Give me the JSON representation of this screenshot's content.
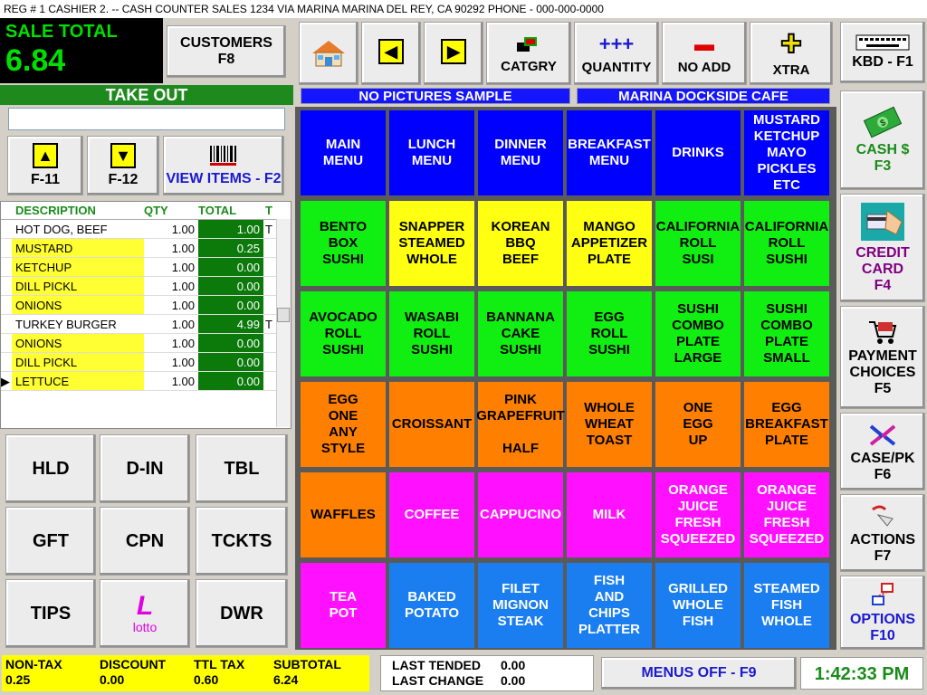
{
  "title": "REG # 1 CASHIER 2. -- CASH COUNTER SALES 1234 VIA MARINA MARINA DEL REY, CA 90292 PHONE - 000-000-0000",
  "sale": {
    "label": "SALE TOTAL",
    "value": "6.84"
  },
  "customers": {
    "line1": "CUSTOMERS",
    "line2": "F8"
  },
  "order_type": "TAKE OUT",
  "nav": {
    "up_label": "F-11",
    "down_label": "F-12",
    "view_items": "VIEW ITEMS - F2"
  },
  "grid": {
    "headers": [
      "DESCRIPTION",
      "QTY",
      "TOTAL",
      "T"
    ],
    "rows": [
      {
        "desc": "HOT DOG, BEEF",
        "qty": "1.00",
        "total": "1.00",
        "t": "T",
        "mod": false
      },
      {
        "desc": "MUSTARD",
        "qty": "1.00",
        "total": "0.25",
        "t": "",
        "mod": true
      },
      {
        "desc": "KETCHUP",
        "qty": "1.00",
        "total": "0.00",
        "t": "",
        "mod": true
      },
      {
        "desc": "DILL PICKL",
        "qty": "1.00",
        "total": "0.00",
        "t": "",
        "mod": true
      },
      {
        "desc": "ONIONS",
        "qty": "1.00",
        "total": "0.00",
        "t": "",
        "mod": true
      },
      {
        "desc": "TURKEY BURGER",
        "qty": "1.00",
        "total": "4.99",
        "t": "T",
        "mod": false
      },
      {
        "desc": "ONIONS",
        "qty": "1.00",
        "total": "0.00",
        "t": "",
        "mod": true
      },
      {
        "desc": "DILL PICKL",
        "qty": "1.00",
        "total": "0.00",
        "t": "",
        "mod": true
      },
      {
        "desc": "LETTUCE",
        "qty": "1.00",
        "total": "0.00",
        "t": "",
        "mod": true
      }
    ]
  },
  "func": {
    "hld": "HLD",
    "din": "D-IN",
    "tbl": "TBL",
    "gft": "GFT",
    "cpn": "CPN",
    "tckts": "TCKTS",
    "tips": "TIPS",
    "lotto_l": "L",
    "lotto": "lotto",
    "dwr": "DWR"
  },
  "toolbar": {
    "catgry": "CATGRY",
    "quantity": "QUANTITY",
    "noadd": "NO ADD",
    "xtra": "XTRA",
    "qty_icon": "+++",
    "noadd_icon": "▬",
    "xtra_icon": "✚"
  },
  "banners": {
    "left": "NO PICTURES SAMPLE",
    "right": "MARINA DOCKSIDE CAFE"
  },
  "menu": [
    [
      {
        "t": "MAIN\nMENU",
        "c": "blue"
      },
      {
        "t": "LUNCH\nMENU",
        "c": "blue"
      },
      {
        "t": "DINNER\nMENU",
        "c": "blue"
      },
      {
        "t": "BREAKFAST\nMENU",
        "c": "blue"
      },
      {
        "t": "DRINKS",
        "c": "blue"
      },
      {
        "t": "MUSTARD\nKETCHUP\nMAYO\nPICKLES\nETC",
        "c": "blue"
      }
    ],
    [
      {
        "t": "BENTO\nBOX\nSUSHI",
        "c": "green"
      },
      {
        "t": "SNAPPER\nSTEAMED\nWHOLE",
        "c": "yellow"
      },
      {
        "t": "KOREAN\nBBQ\nBEEF",
        "c": "yellow"
      },
      {
        "t": "MANGO\nAPPETIZER\nPLATE",
        "c": "yellow"
      },
      {
        "t": "CALIFORNIA\nROLL\nSUSI",
        "c": "green"
      },
      {
        "t": "CALIFORNIA\nROLL\nSUSHI",
        "c": "green"
      }
    ],
    [
      {
        "t": "AVOCADO\nROLL\nSUSHI",
        "c": "green"
      },
      {
        "t": "WASABI\nROLL\nSUSHI",
        "c": "green"
      },
      {
        "t": "BANNANA\nCAKE\nSUSHI",
        "c": "green"
      },
      {
        "t": "EGG\nROLL\nSUSHI",
        "c": "green"
      },
      {
        "t": "SUSHI\nCOMBO\nPLATE\nLARGE",
        "c": "green"
      },
      {
        "t": "SUSHI\nCOMBO\nPLATE\nSMALL",
        "c": "green"
      }
    ],
    [
      {
        "t": "EGG\nONE\nANY\nSTYLE",
        "c": "orange"
      },
      {
        "t": "CROISSANT",
        "c": "orange"
      },
      {
        "t": "PINK\nGRAPEFRUIT\n\nHALF",
        "c": "orange"
      },
      {
        "t": "WHOLE\nWHEAT\nTOAST",
        "c": "orange"
      },
      {
        "t": "ONE\nEGG\nUP",
        "c": "orange"
      },
      {
        "t": "EGG\nBREAKFAST\nPLATE",
        "c": "orange"
      }
    ],
    [
      {
        "t": "WAFFLES",
        "c": "orange"
      },
      {
        "t": "COFFEE",
        "c": "magenta"
      },
      {
        "t": "CAPPUCINO",
        "c": "magenta"
      },
      {
        "t": "MILK",
        "c": "magenta"
      },
      {
        "t": "ORANGE\nJUICE\nFRESH\nSQUEEZED",
        "c": "magenta"
      },
      {
        "t": "ORANGE\nJUICE\nFRESH\nSQUEEZED",
        "c": "magenta"
      }
    ],
    [
      {
        "t": "TEA\nPOT",
        "c": "magenta"
      },
      {
        "t": "BAKED\nPOTATO",
        "c": "sky"
      },
      {
        "t": "FILET\nMIGNON\nSTEAK",
        "c": "sky"
      },
      {
        "t": "FISH\nAND\nCHIPS\nPLATTER",
        "c": "sky"
      },
      {
        "t": "GRILLED\nWHOLE\nFISH",
        "c": "sky"
      },
      {
        "t": "STEAMED\nFISH\nWHOLE",
        "c": "sky"
      }
    ]
  ],
  "side": {
    "kbd": "KBD - F1",
    "cash1": "CASH $",
    "cash2": "F3",
    "credit1": "CREDIT",
    "credit2": "CARD",
    "credit3": "F4",
    "pay1": "PAYMENT",
    "pay2": "CHOICES",
    "pay3": "F5",
    "case1": "CASE/PK",
    "case2": "F6",
    "act1": "ACTIONS",
    "act2": "F7",
    "opt1": "OPTIONS",
    "opt2": "F10"
  },
  "totals": {
    "nontax_l": "NON-TAX",
    "nontax_v": "0.25",
    "discount_l": "DISCOUNT",
    "discount_v": "0.00",
    "ttltax_l": "TTL TAX",
    "ttltax_v": "0.60",
    "subtotal_l": "SUBTOTAL",
    "subtotal_v": "6.24"
  },
  "last": {
    "tended_l": "LAST TENDED",
    "tended_v": "0.00",
    "change_l": "LAST CHANGE",
    "change_v": "0.00"
  },
  "menus_off": "MENUS OFF - F9",
  "clock": "1:42:33 PM",
  "colors": {
    "blue": "#0000ff",
    "green": "#11ee11",
    "yellow": "#ffff11",
    "orange": "#ff8000",
    "magenta": "#ff11ff",
    "sky": "#1a7ef0"
  }
}
